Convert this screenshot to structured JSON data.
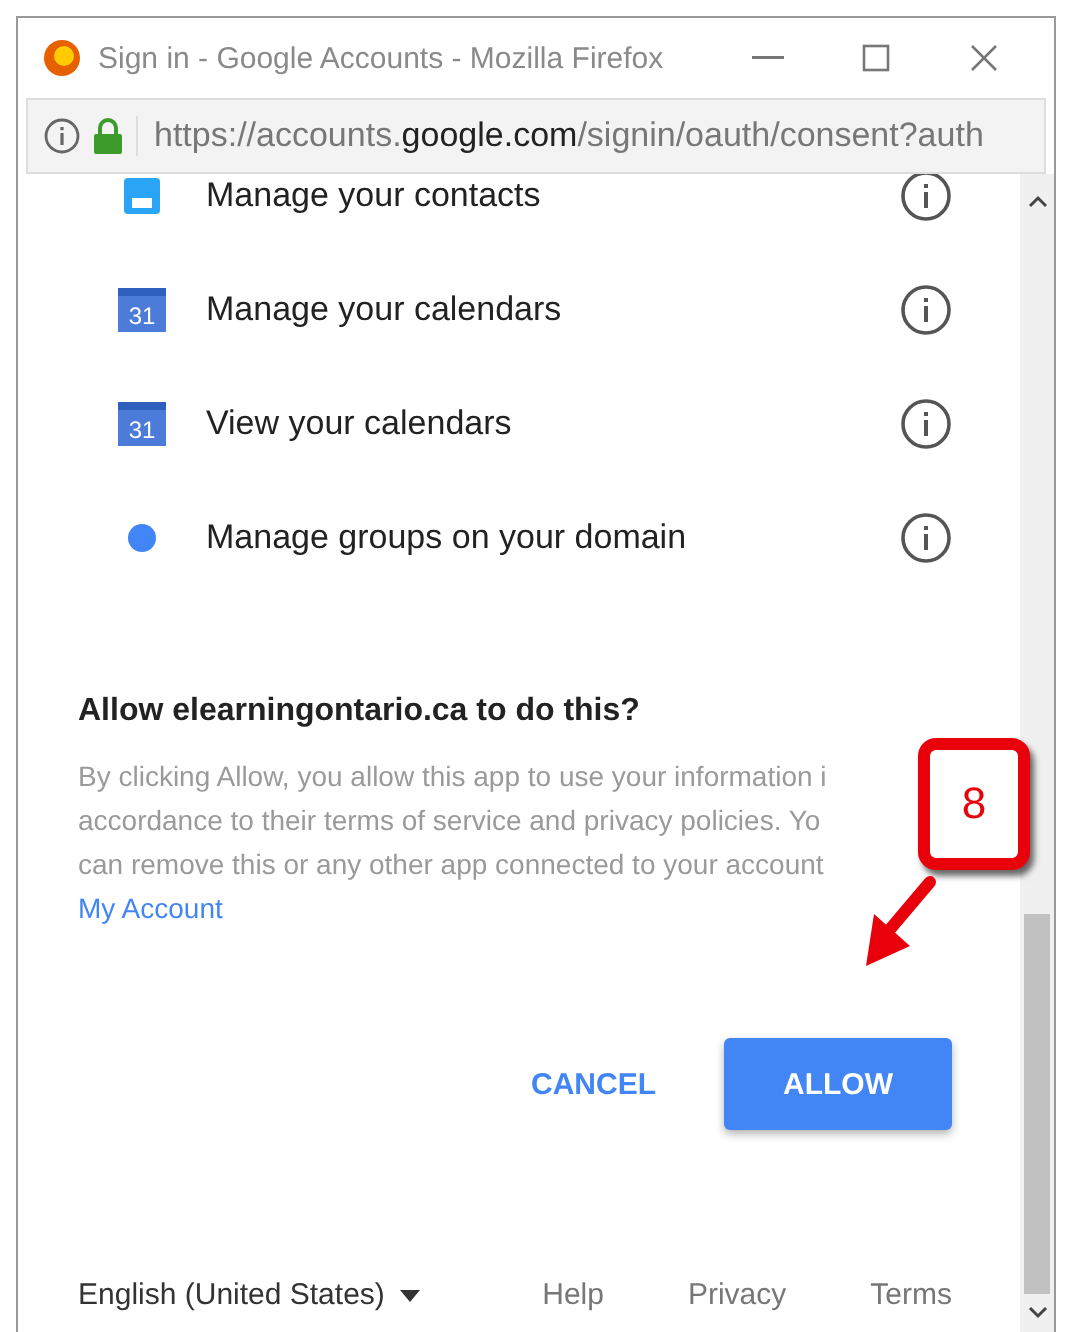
{
  "window": {
    "title": "Sign in - Google Accounts - Mozilla Firefox"
  },
  "address_bar": {
    "url_prefix": "https://accounts.",
    "url_domain": "google.com",
    "url_suffix": "/signin/oauth/consent?auth"
  },
  "permissions": [
    {
      "kind": "contacts",
      "label": "Manage your contacts"
    },
    {
      "kind": "calendar",
      "label": "Manage your calendars",
      "icon_text": "31"
    },
    {
      "kind": "calendar",
      "label": "View your calendars",
      "icon_text": "31"
    },
    {
      "kind": "dot",
      "label": "Manage groups on your domain"
    }
  ],
  "consent": {
    "heading": "Allow elearningontario.ca to do this?",
    "lines": [
      "By clicking Allow, you allow this app to use your information i",
      "accordance to their terms of service and privacy policies. Yo",
      "can remove this or any other app connected to your account"
    ],
    "link": "My Account"
  },
  "buttons": [
    {
      "kind": "text",
      "label": "CANCEL"
    },
    {
      "kind": "primary",
      "label": "ALLOW"
    }
  ],
  "footer": {
    "language": "English (United States)",
    "links": [
      "Help",
      "Privacy",
      "Terms"
    ]
  },
  "callout": {
    "number": "8"
  }
}
